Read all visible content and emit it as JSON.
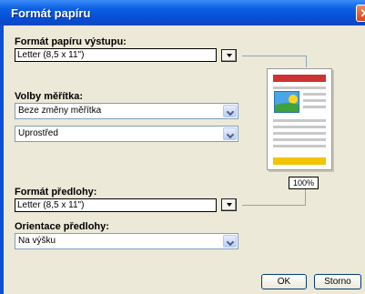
{
  "window": {
    "title": "Formát papíru"
  },
  "output_format": {
    "label": "Formát papíru výstupu:",
    "value": "Letter (8,5 x 11\")"
  },
  "scale": {
    "label": "Volby měřítka:",
    "value": "Beze změny měřítka",
    "position_value": "Uprostřed"
  },
  "source_format": {
    "label": "Formát předlohy:",
    "value": "Letter (8,5 x 11\")"
  },
  "orientation": {
    "label": "Orientace předlohy:",
    "value": "Na výšku"
  },
  "preview": {
    "zoom": "100%"
  },
  "buttons": {
    "ok": "OK",
    "cancel": "Storno"
  },
  "colors": {
    "title_bar": "#0a5fe3",
    "preview_header": "#cc3333",
    "preview_footer": "#f0c400"
  }
}
